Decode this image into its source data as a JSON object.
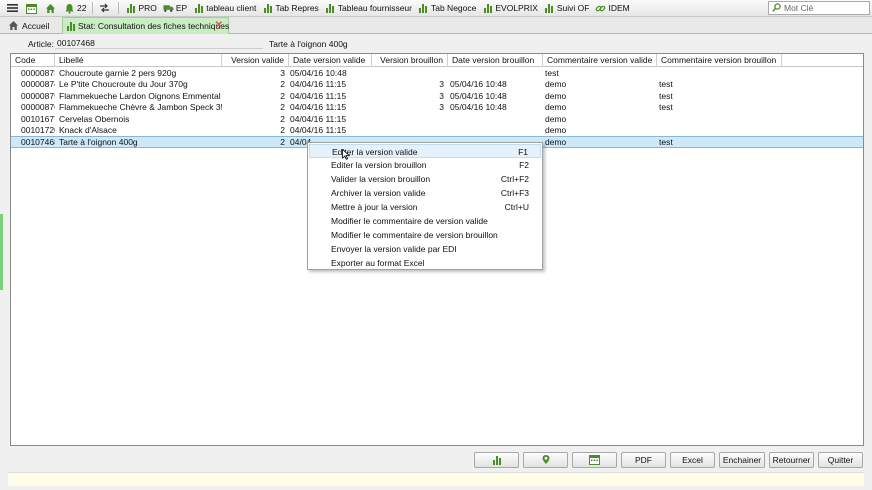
{
  "toolbar": {
    "count_badge": "22",
    "items": [
      {
        "label": "PRO",
        "icon": "bar-chart-icon"
      },
      {
        "label": "EP",
        "icon": "truck-icon"
      },
      {
        "label": "tableau client",
        "icon": "bar-chart-icon"
      },
      {
        "label": "Tab Repres",
        "icon": "bar-chart-icon"
      },
      {
        "label": "Tableau fournisseur",
        "icon": "bar-chart-icon"
      },
      {
        "label": "Tab Negoce",
        "icon": "bar-chart-icon"
      },
      {
        "label": "EVOLPRIX",
        "icon": "bar-chart-icon"
      },
      {
        "label": "Suivi OF",
        "icon": "bar-chart-icon"
      },
      {
        "label": "IDEM",
        "icon": "link-icon"
      }
    ],
    "search_placeholder": "Mot Clé"
  },
  "tabs": {
    "home": "Accueil",
    "active": "Stat: Consultation des fiches techniques"
  },
  "article": {
    "label": "Article:",
    "code": "00107468",
    "name": "Tarte à l'oignon 400g"
  },
  "table": {
    "columns": [
      "Code",
      "Libellé",
      "Version valide",
      "Date version valide",
      "Version brouillon",
      "Date version brouillon",
      "Commentaire version valide",
      "Commentaire version brouillon"
    ],
    "rows": [
      [
        "00000873",
        "Choucroute garnie 2 pers 920g",
        "3",
        "05/04/16 10:48",
        "",
        "",
        "test",
        ""
      ],
      [
        "00000874",
        "Le P'tite Choucroute du Jour 370g",
        "2",
        "04/04/16 11:15",
        "3",
        "05/04/16 10:48",
        "demo",
        "test"
      ],
      [
        "00000875",
        "Flammekueche Lardon Oignons Emmental 180g",
        "2",
        "04/04/16 11:15",
        "3",
        "05/04/16 10:48",
        "demo",
        "test"
      ],
      [
        "00000876",
        "Flammekueche Chèvre & Jambon Speck 350g",
        "2",
        "04/04/16 11:15",
        "3",
        "05/04/16 10:48",
        "demo",
        "test"
      ],
      [
        "00101677",
        "Cervelas Obernois",
        "2",
        "04/04/16 11:15",
        "",
        "",
        "demo",
        ""
      ],
      [
        "00101720",
        "Knack d'Alsace",
        "2",
        "04/04/16 11:15",
        "",
        "",
        "demo",
        ""
      ],
      [
        "00107468",
        "Tarte à l'oignon 400g",
        "2",
        "04/04",
        "",
        "",
        "demo",
        "test"
      ]
    ]
  },
  "context_menu": {
    "items": [
      {
        "label": "Editer la version valide",
        "shortcut": "F1"
      },
      {
        "label": "Editer la version brouillon",
        "shortcut": "F2"
      },
      {
        "label": "Valider la version brouillon",
        "shortcut": "Ctrl+F2"
      },
      {
        "label": "Archiver la version valide",
        "shortcut": "Ctrl+F3"
      },
      {
        "label": "Mettre à jour la version",
        "shortcut": "Ctrl+U"
      },
      {
        "label": "Modifier le commentaire de version valide",
        "shortcut": ""
      },
      {
        "label": "Modifier le commentaire de version brouillon",
        "shortcut": ""
      },
      {
        "label": "Envoyer la version valide par EDI",
        "shortcut": ""
      },
      {
        "label": "Exporter au format Excel",
        "shortcut": ""
      }
    ]
  },
  "buttons": {
    "pdf": "PDF",
    "excel": "Excel",
    "chain": "Enchainer",
    "back": "Retourner",
    "quit": "Quitter"
  },
  "colors": {
    "accent_green": "#4c8c2b",
    "active_tab": "#c9ecc4",
    "selected_row": "#cde8f8"
  }
}
